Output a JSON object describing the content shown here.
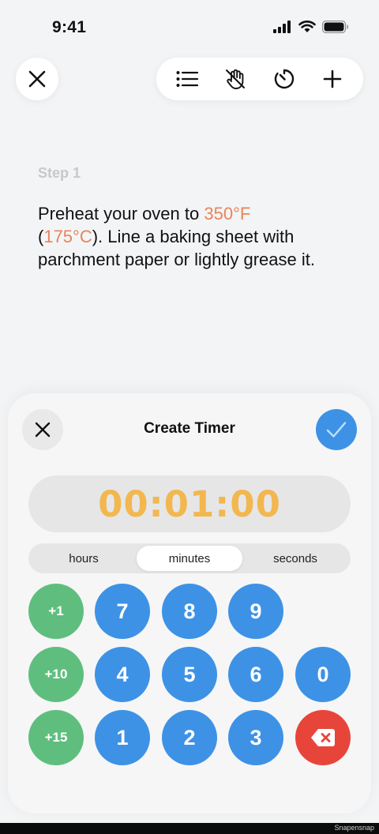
{
  "status_bar": {
    "time": "9:41"
  },
  "toolbar": {
    "close_icon": "close-icon",
    "buttons": [
      {
        "icon": "list-icon"
      },
      {
        "icon": "hand-off-icon"
      },
      {
        "icon": "timer-icon"
      },
      {
        "icon": "plus-icon"
      }
    ]
  },
  "step": {
    "label": "Step 1",
    "text_before": "Preheat your oven to ",
    "temp_f": "350°F",
    "text_open": "(",
    "temp_c": "175°C",
    "text_after": "). Line a baking sheet with parchment paper or lightly grease it."
  },
  "timer_sheet": {
    "title": "Create Timer",
    "time_value": "00:01:00",
    "units": [
      "hours",
      "minutes",
      "seconds"
    ],
    "active_unit": "minutes",
    "keys": {
      "plus1": "+1",
      "plus10": "+10",
      "plus15": "+15",
      "d7": "7",
      "d8": "8",
      "d9": "9",
      "d4": "4",
      "d5": "5",
      "d6": "6",
      "d0": "0",
      "d1": "1",
      "d2": "2",
      "d3": "3"
    }
  },
  "colors": {
    "accent_blue": "#3d92e6",
    "accent_green": "#5fbe7e",
    "accent_red": "#e8453a",
    "timer_yellow": "#f2b74f",
    "temperature_orange": "#e8845c"
  },
  "watermark": "Snapensnap"
}
